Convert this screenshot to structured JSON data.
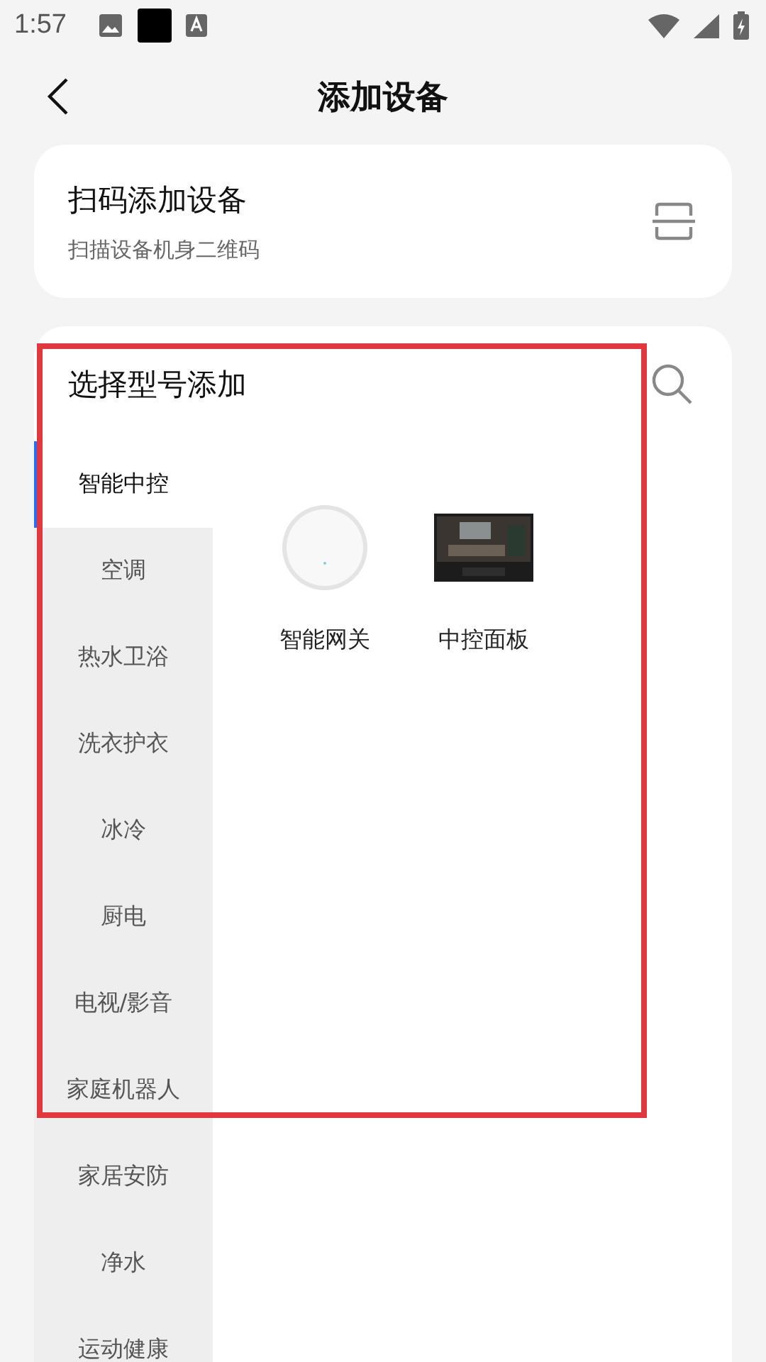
{
  "status_bar": {
    "time": "1:57"
  },
  "header": {
    "title": "添加设备"
  },
  "scan_card": {
    "title": "扫码添加设备",
    "subtitle": "扫描设备机身二维码"
  },
  "model_section": {
    "title": "选择型号添加"
  },
  "categories": [
    {
      "label": "智能中控",
      "selected": true
    },
    {
      "label": "空调",
      "selected": false
    },
    {
      "label": "热水卫浴",
      "selected": false
    },
    {
      "label": "洗衣护衣",
      "selected": false
    },
    {
      "label": "冰冷",
      "selected": false
    },
    {
      "label": "厨电",
      "selected": false
    },
    {
      "label": "电视/影音",
      "selected": false
    },
    {
      "label": "家庭机器人",
      "selected": false
    },
    {
      "label": "家居安防",
      "selected": false
    },
    {
      "label": "净水",
      "selected": false
    },
    {
      "label": "运动健康",
      "selected": false
    }
  ],
  "products": [
    {
      "name": "智能网关",
      "kind": "gateway"
    },
    {
      "name": "中控面板",
      "kind": "panel"
    }
  ],
  "highlight_frame": {
    "shown": true
  }
}
